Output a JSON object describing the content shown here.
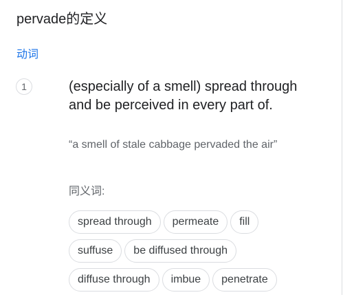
{
  "header": {
    "title": "pervade的定义"
  },
  "entry": {
    "part_of_speech": "动词",
    "sense_number": "1",
    "definition": "(especially of a smell) spread through and be perceived in every part of.",
    "example": "“a smell of stale cabbage pervaded the air”",
    "synonyms_label": "同义词:",
    "synonyms": [
      [
        "spread through",
        "permeate",
        "fill"
      ],
      [
        "suffuse",
        "be diffused through"
      ],
      [
        "diffuse through",
        "imbue",
        "penetrate"
      ]
    ]
  },
  "colors": {
    "link_blue": "#1a73e8",
    "text_primary": "#202124",
    "text_secondary": "#5f6368",
    "border": "#dadce0"
  }
}
